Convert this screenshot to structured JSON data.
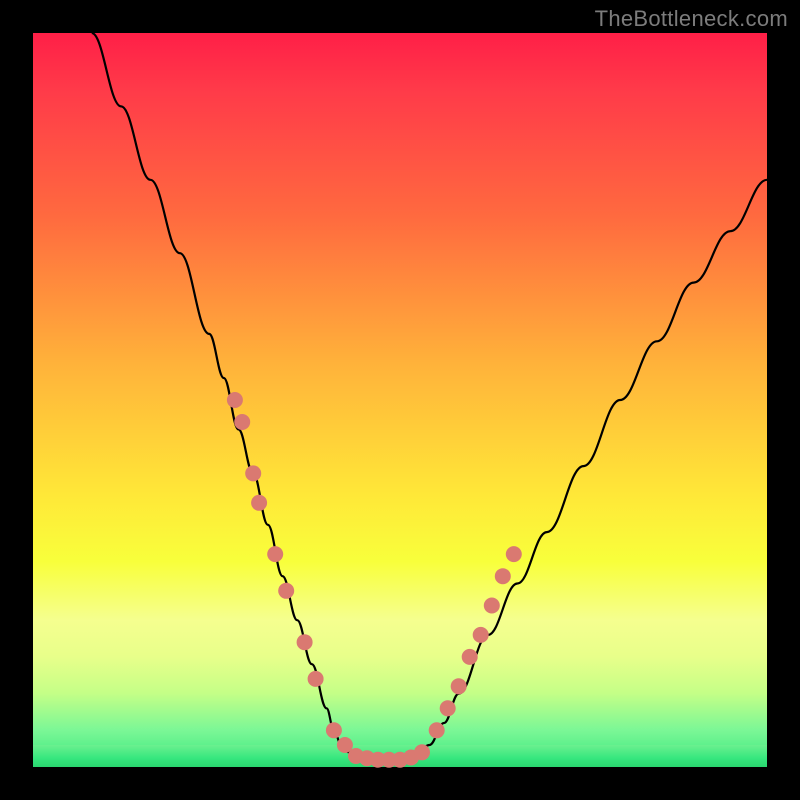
{
  "watermark": "TheBottleneck.com",
  "chart_data": {
    "type": "line",
    "title": "",
    "xlabel": "",
    "ylabel": "",
    "xlim": [
      0,
      100
    ],
    "ylim": [
      0,
      100
    ],
    "grid": false,
    "series": [
      {
        "name": "bottleneck-curve",
        "x": [
          8,
          12,
          16,
          20,
          24,
          26,
          28,
          30,
          32,
          34,
          36,
          38,
          40,
          41,
          42,
          43,
          44,
          46,
          48,
          50,
          52,
          54,
          56,
          58,
          62,
          66,
          70,
          75,
          80,
          85,
          90,
          95,
          100
        ],
        "y": [
          100,
          90,
          80,
          70,
          59,
          53,
          46,
          40,
          33,
          26,
          20,
          14,
          8,
          5,
          3,
          2,
          1.5,
          1,
          1,
          1,
          1.5,
          3,
          6,
          10,
          18,
          25,
          32,
          41,
          50,
          58,
          66,
          73,
          80
        ]
      }
    ],
    "markers": [
      {
        "name": "left-cluster",
        "x": [
          27.5,
          28.5,
          30,
          30.8,
          33,
          34.5,
          37,
          38.5,
          41,
          42.5
        ],
        "y": [
          50,
          47,
          40,
          36,
          29,
          24,
          17,
          12,
          5,
          3
        ]
      },
      {
        "name": "floor-cluster",
        "x": [
          44,
          45.5,
          47,
          48.5,
          50,
          51.5,
          53
        ],
        "y": [
          1.5,
          1.2,
          1,
          1,
          1,
          1.3,
          2
        ]
      },
      {
        "name": "right-cluster",
        "x": [
          55,
          56.5,
          58,
          59.5,
          61,
          62.5,
          64,
          65.5
        ],
        "y": [
          5,
          8,
          11,
          15,
          18,
          22,
          26,
          29
        ]
      }
    ],
    "background": {
      "type": "vertical-gradient",
      "stops": [
        {
          "pos": 0,
          "color": "#ff1f47"
        },
        {
          "pos": 0.45,
          "color": "#ffb23a"
        },
        {
          "pos": 0.72,
          "color": "#f8ff3b"
        },
        {
          "pos": 1,
          "color": "#36e77e"
        }
      ]
    }
  }
}
